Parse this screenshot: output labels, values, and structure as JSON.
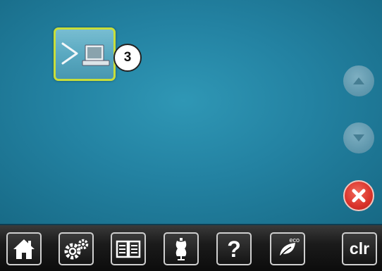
{
  "main": {
    "transfer_tile": {
      "icon": "transfer-to-computer-icon",
      "badge": "3"
    },
    "scroll": {
      "up_icon": "chevron-up-icon",
      "down_icon": "chevron-down-icon"
    },
    "close_icon": "close-icon"
  },
  "toolbar": {
    "items": [
      {
        "id": "home",
        "icon": "home-icon"
      },
      {
        "id": "setup",
        "icon": "gears-icon"
      },
      {
        "id": "tutorial",
        "icon": "book-icon"
      },
      {
        "id": "creative-consultant",
        "icon": "dress-form-icon"
      },
      {
        "id": "help",
        "icon": "question-icon",
        "label": "?"
      },
      {
        "id": "eco",
        "icon": "leaf-icon",
        "label": "eco"
      },
      {
        "id": "clear",
        "icon": "clr-icon",
        "label": "clr"
      }
    ]
  },
  "colors": {
    "background": "#2382a2",
    "tile_border": "#c8de3a",
    "close": "#d9322a",
    "toolbar": "#141414"
  }
}
